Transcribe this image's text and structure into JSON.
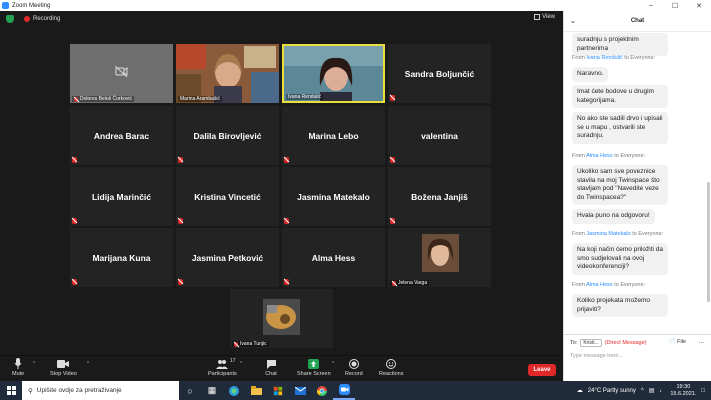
{
  "window": {
    "title": "Zoom Meeting"
  },
  "meeting": {
    "recording_label": "Recording",
    "view_label": "View"
  },
  "tiles": {
    "dolores": "Dolores Beloš Ćorković",
    "marina_a": "Marina Arambašić",
    "ivana_r": "Ivana Rendulić",
    "sandra": "Sandra Boljunčić",
    "andrea": "Andrea Barac",
    "dalila": "Dalila Birovljević",
    "marina_l": "Marina Lebo",
    "valentina": "valentina",
    "lidija": "Lidija Marinčić",
    "kristina": "Kristina Vincetić",
    "jasmina_m": "Jasmina Matekalo",
    "bozena": "Božena Janjiš",
    "marijana": "Marijana Kuna",
    "jasmina_p": "Jasmina Petković",
    "alma": "Alma Hess",
    "jelena": "Jelena Varga",
    "ivana_t": "Ivana Tunjic"
  },
  "toolbar": {
    "mute": "Mute",
    "stop_video": "Stop Video",
    "participants": "Participants",
    "participants_count": "17",
    "chat": "Chat",
    "share_screen": "Share Screen",
    "record": "Record",
    "reactions": "Reactions",
    "leave": "Leave"
  },
  "chat": {
    "title": "Chat",
    "partial_top": "suradnju s projektnim partnerima",
    "from_prefix": "From",
    "to_everyone": "to Everyone:",
    "m1_from": "Ivana Rendulić",
    "m1_a": "Naravno.",
    "m1_b": "Imat ćete bodove u drugim kategorijama.",
    "m1_c": "No ako ste sadili drvo i upisali se u mapu , ostvarili ste suradnju.",
    "m2_from": "Alma Hess",
    "m2_a": "Ukoliko sam sve poveznice stavila na moj Twinspace što stavljam pod \"Navedite veze do Twinspacea?\"",
    "m2_b": "Hvala puno na odgovoru!",
    "m3_from": "Jasmina Matekalo",
    "m3_a": "Na koji način ćemo priložiti da smo sudjelovali na ovoj videokonferenciji?",
    "m4_from": "Alma Hess",
    "m4_a": "Koliko projekata možemo prijaviti?",
    "to_label": "To:",
    "to_value": "Kristi...",
    "direct_label": "(Direct Message)",
    "file_label": "File",
    "more_label": "...",
    "input_placeholder": "Type message here..."
  },
  "taskbar": {
    "search_placeholder": "Upišite ovdje za pretraživanje",
    "weather": "24°C  Partly sunny",
    "time": "19:30",
    "date": "15.6.2021."
  },
  "colors": {
    "accent": "#2d8cff",
    "leave": "#e02828",
    "highlight": "#e9df3b",
    "share": "#23a455"
  }
}
